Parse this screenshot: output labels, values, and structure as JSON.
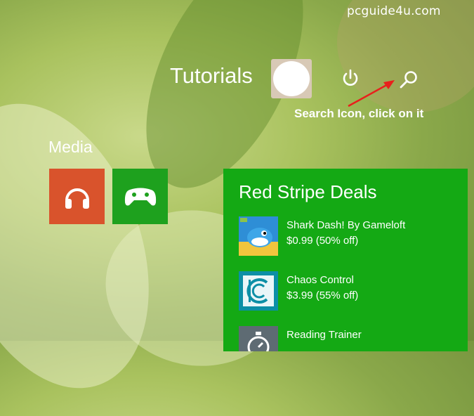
{
  "watermark": "pcguide4u.com",
  "header": {
    "user_name": "Tutorials",
    "power_icon": "power-icon",
    "search_icon": "search-icon"
  },
  "annotation": {
    "text": "Search Icon, click on it",
    "arrow_color": "#e8201c"
  },
  "media_group": {
    "label": "Media",
    "tiles": [
      {
        "icon": "headphones-icon",
        "color": "#d9532c"
      },
      {
        "icon": "game-controller-icon",
        "color": "#1ea11e"
      }
    ]
  },
  "store_tile": {
    "title": "Red Stripe Deals",
    "color": "#14a914",
    "deals": [
      {
        "name": "Shark Dash! By Gameloft",
        "price": "$0.99 (50% off)",
        "icon": "shark-dash-app-icon"
      },
      {
        "name": "Chaos Control",
        "price": "$3.99 (55% off)",
        "icon": "chaos-control-app-icon"
      },
      {
        "name": "Reading Trainer",
        "price": "",
        "icon": "reading-trainer-app-icon"
      }
    ]
  }
}
